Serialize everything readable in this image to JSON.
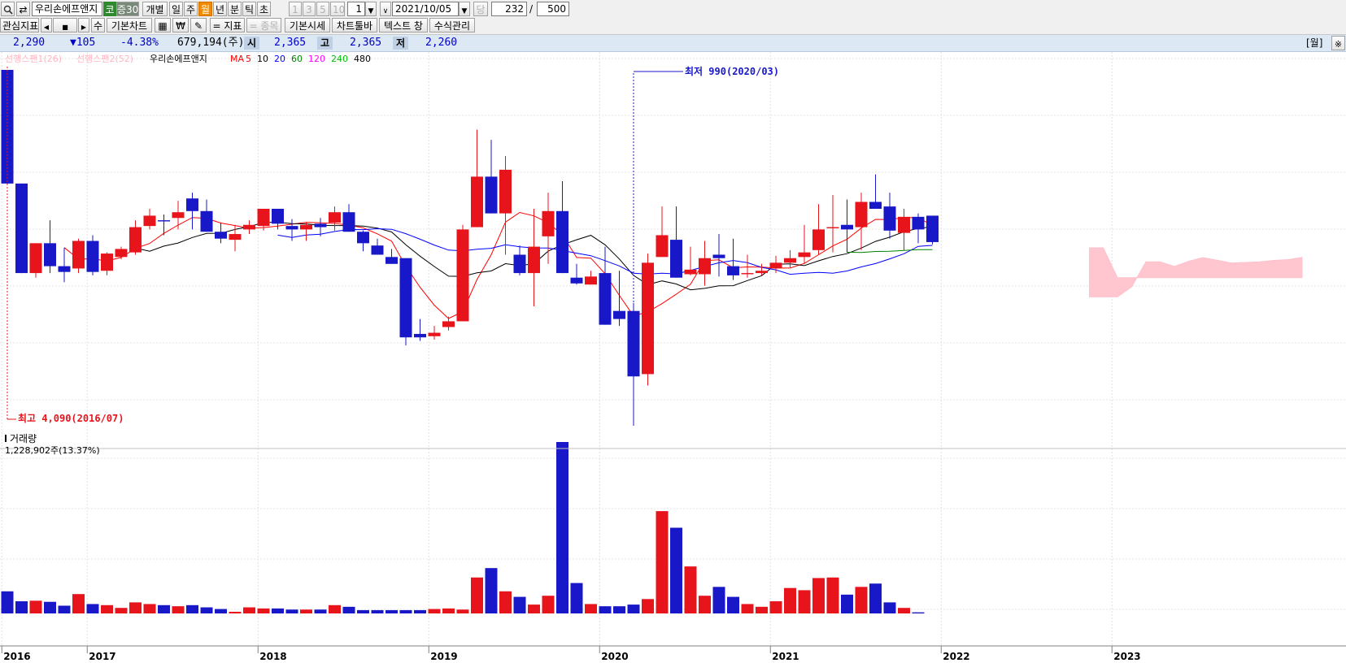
{
  "toolbar": {
    "stock_name": "우리손에프앤지",
    "market_badge": "코",
    "margin_badge": "증30",
    "individual_btn": "개별",
    "period_day": "일",
    "period_week": "주",
    "period_month": "월",
    "period_year": "년",
    "period_minute": "분",
    "period_tick": "틱",
    "period_second": "초",
    "num1": "1",
    "num3": "3",
    "num5": "5",
    "num10": "10",
    "unit_value": "1",
    "date_value": "2021/10/05",
    "date_label": "당",
    "count_value": "232",
    "count_sep": "/",
    "count_total": "500",
    "interest_btn": "관심지표",
    "su_btn": "수",
    "basic_chart_btn": "기본차트",
    "indicator_btn": "= 지표",
    "item_btn": "= 종목",
    "basic_quote_btn": "기본시세",
    "chart_toolbar_btn": "차트툴바",
    "text_btn": "텍스트 창",
    "formula_btn": "수식관리",
    "won_icon": "₩"
  },
  "info": {
    "price": "2,290",
    "change": "▼105",
    "change_pct": "-4.38%",
    "volume": "679,194(주)",
    "open_label": "시",
    "open": "2,365",
    "high_label": "고",
    "high": "2,365",
    "low_label": "저",
    "low": "2,260",
    "period_tag": "[월]"
  },
  "legend": {
    "span1": "선행스팬1(26)",
    "span2": "선행스팬2(52)",
    "name": "우리손에프앤지",
    "ma_label": "MA",
    "ma_periods": [
      "5",
      "10",
      "20",
      "60",
      "120",
      "240",
      "480"
    ],
    "ma_colors": [
      "#ff0000",
      "#000000",
      "#0000ff",
      "#008000",
      "#ff00ff",
      "#00c000",
      "#000000"
    ]
  },
  "annotations": {
    "high": "최고 4,090(2016/07)",
    "low": "최저 990(2020/03)"
  },
  "volume_panel": {
    "title": "거래량",
    "value": "1,228,902주(13.37%)"
  },
  "colors": {
    "up": "#e8141c",
    "down": "#1818c8",
    "cloud": "#ffc0cb"
  },
  "chart_data": {
    "type": "candlestick",
    "x_labels": [
      "2016",
      "2017",
      "2018",
      "2019",
      "2020",
      "2021",
      "2022",
      "2023"
    ],
    "x_label_index": [
      0,
      6,
      18,
      30,
      42,
      54,
      66,
      78
    ],
    "y_range": [
      990,
      4090
    ],
    "candles": [
      {
        "o": 4090,
        "h": 4090,
        "l": 3100,
        "c": 3100
      },
      {
        "o": 3100,
        "h": 3100,
        "l": 2320,
        "c": 2320
      },
      {
        "o": 2320,
        "h": 2580,
        "l": 2280,
        "c": 2580
      },
      {
        "o": 2580,
        "h": 2780,
        "l": 2320,
        "c": 2380
      },
      {
        "o": 2380,
        "h": 2540,
        "l": 2240,
        "c": 2330
      },
      {
        "o": 2360,
        "h": 2620,
        "l": 2320,
        "c": 2600
      },
      {
        "o": 2600,
        "h": 2650,
        "l": 2300,
        "c": 2330
      },
      {
        "o": 2340,
        "h": 2500,
        "l": 2300,
        "c": 2490
      },
      {
        "o": 2460,
        "h": 2550,
        "l": 2440,
        "c": 2530
      },
      {
        "o": 2500,
        "h": 2780,
        "l": 2480,
        "c": 2720
      },
      {
        "o": 2730,
        "h": 2880,
        "l": 2700,
        "c": 2820
      },
      {
        "o": 2780,
        "h": 2830,
        "l": 2650,
        "c": 2770
      },
      {
        "o": 2800,
        "h": 2950,
        "l": 2700,
        "c": 2850
      },
      {
        "o": 2970,
        "h": 3020,
        "l": 2700,
        "c": 2860
      },
      {
        "o": 2860,
        "h": 2960,
        "l": 2820,
        "c": 2680
      },
      {
        "o": 2680,
        "h": 2760,
        "l": 2580,
        "c": 2620
      },
      {
        "o": 2610,
        "h": 2740,
        "l": 2510,
        "c": 2660
      },
      {
        "o": 2700,
        "h": 2780,
        "l": 2660,
        "c": 2740
      },
      {
        "o": 2730,
        "h": 2880,
        "l": 2690,
        "c": 2880
      },
      {
        "o": 2880,
        "h": 2880,
        "l": 2700,
        "c": 2750
      },
      {
        "o": 2730,
        "h": 2790,
        "l": 2600,
        "c": 2700
      },
      {
        "o": 2700,
        "h": 2760,
        "l": 2600,
        "c": 2740
      },
      {
        "o": 2750,
        "h": 2800,
        "l": 2640,
        "c": 2720
      },
      {
        "o": 2760,
        "h": 2900,
        "l": 2690,
        "c": 2850
      },
      {
        "o": 2850,
        "h": 2920,
        "l": 2730,
        "c": 2680
      },
      {
        "o": 2680,
        "h": 2690,
        "l": 2510,
        "c": 2580
      },
      {
        "o": 2560,
        "h": 2620,
        "l": 2480,
        "c": 2480
      },
      {
        "o": 2460,
        "h": 2530,
        "l": 2420,
        "c": 2400
      },
      {
        "o": 2450,
        "h": 2400,
        "l": 1690,
        "c": 1760
      },
      {
        "o": 1790,
        "h": 1920,
        "l": 1730,
        "c": 1760
      },
      {
        "o": 1770,
        "h": 1860,
        "l": 1740,
        "c": 1800
      },
      {
        "o": 1850,
        "h": 1940,
        "l": 1820,
        "c": 1900
      },
      {
        "o": 1900,
        "h": 2740,
        "l": 1900,
        "c": 2700
      },
      {
        "o": 2720,
        "h": 3570,
        "l": 2720,
        "c": 3160
      },
      {
        "o": 3160,
        "h": 3480,
        "l": 2840,
        "c": 2840
      },
      {
        "o": 2840,
        "h": 3340,
        "l": 2480,
        "c": 3220
      },
      {
        "o": 2480,
        "h": 2560,
        "l": 2300,
        "c": 2320
      },
      {
        "o": 2320,
        "h": 2880,
        "l": 2030,
        "c": 2550
      },
      {
        "o": 2640,
        "h": 3020,
        "l": 2400,
        "c": 2860
      },
      {
        "o": 2860,
        "h": 3120,
        "l": 2340,
        "c": 2320
      },
      {
        "o": 2280,
        "h": 2400,
        "l": 2220,
        "c": 2230
      },
      {
        "o": 2220,
        "h": 2340,
        "l": 2220,
        "c": 2290
      },
      {
        "o": 2320,
        "h": 2550,
        "l": 2020,
        "c": 1870
      },
      {
        "o": 1990,
        "h": 2340,
        "l": 1860,
        "c": 1920
      },
      {
        "o": 1990,
        "h": 2060,
        "l": 990,
        "c": 1420
      },
      {
        "o": 1440,
        "h": 2490,
        "l": 1340,
        "c": 2410
      },
      {
        "o": 2460,
        "h": 2900,
        "l": 2460,
        "c": 2650
      },
      {
        "o": 2610,
        "h": 2900,
        "l": 2280,
        "c": 2280
      },
      {
        "o": 2310,
        "h": 2550,
        "l": 2300,
        "c": 2350
      },
      {
        "o": 2310,
        "h": 2600,
        "l": 2210,
        "c": 2450
      },
      {
        "o": 2480,
        "h": 2660,
        "l": 2290,
        "c": 2450
      },
      {
        "o": 2380,
        "h": 2620,
        "l": 2260,
        "c": 2300
      },
      {
        "o": 2310,
        "h": 2480,
        "l": 2280,
        "c": 2320
      },
      {
        "o": 2320,
        "h": 2400,
        "l": 2300,
        "c": 2340
      },
      {
        "o": 2360,
        "h": 2470,
        "l": 2320,
        "c": 2410
      },
      {
        "o": 2410,
        "h": 2520,
        "l": 2370,
        "c": 2450
      },
      {
        "o": 2460,
        "h": 2740,
        "l": 2400,
        "c": 2500
      },
      {
        "o": 2520,
        "h": 2920,
        "l": 2480,
        "c": 2700
      },
      {
        "o": 2710,
        "h": 3000,
        "l": 2500,
        "c": 2720
      },
      {
        "o": 2740,
        "h": 2960,
        "l": 2500,
        "c": 2700
      },
      {
        "o": 2720,
        "h": 3020,
        "l": 2520,
        "c": 2940
      },
      {
        "o": 2940,
        "h": 3180,
        "l": 2880,
        "c": 2880
      },
      {
        "o": 2900,
        "h": 3020,
        "l": 2620,
        "c": 2690
      },
      {
        "o": 2670,
        "h": 2880,
        "l": 2520,
        "c": 2810
      },
      {
        "o": 2810,
        "h": 2840,
        "l": 2580,
        "c": 2700
      },
      {
        "o": 2820,
        "h": 2810,
        "l": 2570,
        "c": 2590
      }
    ],
    "volume_range": [
      0,
      3100000
    ],
    "volumes": [
      400000,
      220000,
      230000,
      210000,
      140000,
      350000,
      170000,
      150000,
      100000,
      200000,
      170000,
      150000,
      130000,
      150000,
      110000,
      80000,
      30000,
      110000,
      90000,
      90000,
      70000,
      70000,
      70000,
      150000,
      120000,
      60000,
      60000,
      60000,
      60000,
      60000,
      80000,
      90000,
      70000,
      650000,
      820000,
      400000,
      300000,
      160000,
      320000,
      3100000,
      550000,
      170000,
      130000,
      130000,
      160000,
      260000,
      1850000,
      1550000,
      850000,
      320000,
      480000,
      300000,
      170000,
      120000,
      220000,
      460000,
      420000,
      640000,
      650000,
      340000,
      480000,
      540000,
      200000,
      100000,
      20000
    ]
  }
}
